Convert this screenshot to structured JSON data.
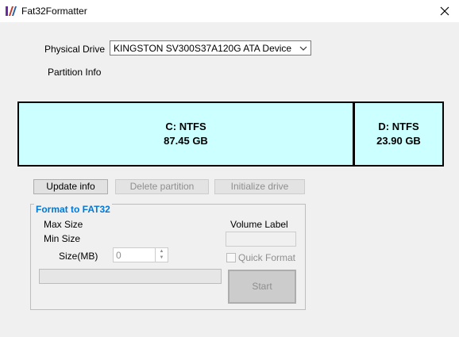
{
  "window": {
    "title": "Fat32Formatter",
    "close_icon": "close-icon"
  },
  "drive": {
    "label": "Physical Drive",
    "selected": "KINGSTON  SV300S37A120G  ATA  Device"
  },
  "partition_info_label": "Partition Info",
  "partitions": [
    {
      "name": "C: NTFS",
      "size": "87.45 GB"
    },
    {
      "name": "D: NTFS",
      "size": "23.90 GB"
    }
  ],
  "colors": {
    "partition_fill": "#ccffff",
    "group_title": "#0078d7"
  },
  "buttons": {
    "update": "Update info",
    "delete": "Delete partition",
    "initialize": "Initialize drive"
  },
  "format": {
    "title": "Format to FAT32",
    "max_size_label": "Max Size",
    "min_size_label": "Min Size",
    "size_mb_label": "Size(MB)",
    "size_value": "0",
    "volume_label": "Volume Label",
    "volume_value": "",
    "quick_format_label": "Quick Format",
    "start_label": "Start"
  }
}
